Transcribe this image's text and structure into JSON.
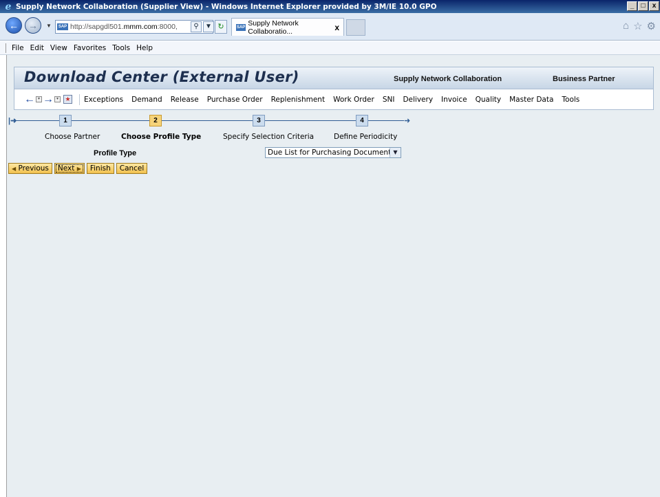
{
  "window": {
    "title": "Supply Network Collaboration (Supplier View) - Windows Internet Explorer provided by 3M/IE 10.0 GPO",
    "controls": [
      "_",
      "□",
      "x"
    ]
  },
  "browser": {
    "url_prefix": "http://sapgdl501.",
    "url_host": "mmm.com",
    "url_suffix": ":8000,",
    "tab_title": "Supply Network Collaboratio...",
    "tab_close": "x",
    "menu": [
      "File",
      "Edit",
      "View",
      "Favorites",
      "Tools",
      "Help"
    ],
    "icons": [
      "home-icon",
      "star-icon",
      "gear-icon"
    ]
  },
  "header": {
    "title": "Download Center (External User)",
    "app_name": "Supply Network Collaboration",
    "business_partner": "Business Partner"
  },
  "toolbar": {
    "menu": [
      "Exceptions",
      "Demand",
      "Release",
      "Purchase Order",
      "Replenishment",
      "Work Order",
      "SNI",
      "Delivery",
      "Invoice",
      "Quality",
      "Master Data",
      "Tools"
    ]
  },
  "roadmap": {
    "steps": [
      {
        "number": "1",
        "label": "Choose Partner",
        "active": false
      },
      {
        "number": "2",
        "label": "Choose Profile Type",
        "active": true
      },
      {
        "number": "3",
        "label": "Specify Selection Criteria",
        "active": false
      },
      {
        "number": "4",
        "label": "Define Periodicity",
        "active": false
      }
    ]
  },
  "form": {
    "profile_type_label": "Profile Type",
    "profile_type_value": "Due List for Purchasing Documents"
  },
  "buttons": {
    "previous": "Previous",
    "next": "Next",
    "finish": "Finish",
    "cancel": "Cancel"
  },
  "colors": {
    "active_step": "#f6d37a",
    "inactive_step": "#cbdcee",
    "button": "#f2c14e",
    "page_bg": "#e8eef2"
  }
}
